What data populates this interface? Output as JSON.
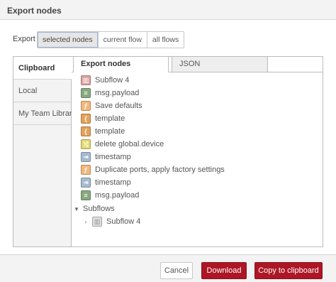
{
  "dialog": {
    "title": "Export nodes"
  },
  "export": {
    "label": "Export",
    "options": [
      "selected nodes",
      "current flow",
      "all flows"
    ],
    "selected": "selected nodes"
  },
  "side_tabs": [
    "Clipboard",
    "Local",
    "My Team Library"
  ],
  "top_tabs": [
    "Export nodes",
    "JSON"
  ],
  "nodes": [
    {
      "label": "Subflow 4",
      "icon": "subflow-icon",
      "color": "#dda4a1",
      "glyph": "▥"
    },
    {
      "label": "msg.payload",
      "icon": "debug-icon",
      "color": "#87a980",
      "glyph": "≡"
    },
    {
      "label": "Save defaults",
      "icon": "function-icon",
      "color": "#f3b87d",
      "glyph": "ƒ"
    },
    {
      "label": "template",
      "icon": "template-icon",
      "color": "#e3a25b",
      "glyph": "{"
    },
    {
      "label": "template",
      "icon": "template-icon",
      "color": "#e3a25b",
      "glyph": "{"
    },
    {
      "label": "delete global.device",
      "icon": "change-icon",
      "color": "#e2d96e",
      "glyph": "⤭"
    },
    {
      "label": "timestamp",
      "icon": "inject-icon",
      "color": "#a6bbcf",
      "glyph": "⇥"
    },
    {
      "label": "Duplicate ports, apply factory settings",
      "icon": "function-icon",
      "color": "#f3b87d",
      "glyph": "ƒ"
    },
    {
      "label": "timestamp",
      "icon": "inject-icon",
      "color": "#a6bbcf",
      "glyph": "⇥"
    },
    {
      "label": "msg.payload",
      "icon": "debug-icon",
      "color": "#87a980",
      "glyph": "≡"
    }
  ],
  "subflows": {
    "label": "Subflows",
    "items": [
      {
        "label": "Subflow 4",
        "icon": "subflow-icon",
        "color": "#dddddd",
        "glyph": "▥"
      }
    ]
  },
  "buttons": {
    "cancel": "Cancel",
    "download": "Download",
    "copy": "Copy to clipboard"
  }
}
